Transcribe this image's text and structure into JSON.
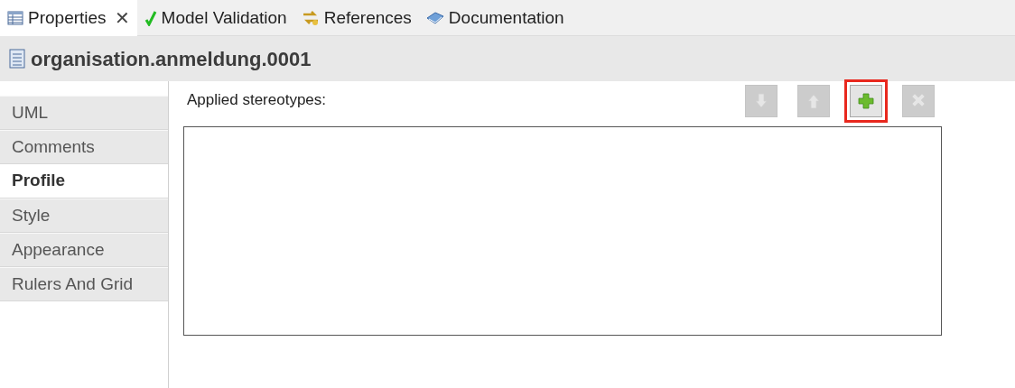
{
  "view_tabs": [
    {
      "label": "Properties",
      "kind": "table",
      "selected": true,
      "close": "✕"
    },
    {
      "label": "Model Validation",
      "kind": "check",
      "selected": false
    },
    {
      "label": "References",
      "kind": "arrows",
      "selected": false
    },
    {
      "label": "Documentation",
      "kind": "book",
      "selected": false
    }
  ],
  "header": {
    "title": "organisation.anmeldung.0001"
  },
  "sidebar": {
    "items": [
      {
        "label": "UML",
        "selected": false
      },
      {
        "label": "Comments",
        "selected": false
      },
      {
        "label": "Profile",
        "selected": true
      },
      {
        "label": "Style",
        "selected": false
      },
      {
        "label": "Appearance",
        "selected": false
      },
      {
        "label": "Rulers And Grid",
        "selected": false
      }
    ]
  },
  "stereotypes": {
    "label": "Applied stereotypes:",
    "buttons": [
      {
        "kind": "down",
        "disabled": true,
        "highlighted": false
      },
      {
        "kind": "up",
        "disabled": true,
        "highlighted": false
      },
      {
        "kind": "add",
        "disabled": false,
        "highlighted": true
      },
      {
        "kind": "remove",
        "disabled": true,
        "highlighted": false
      }
    ]
  }
}
